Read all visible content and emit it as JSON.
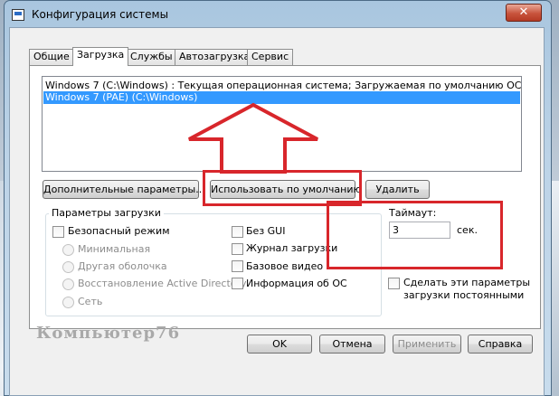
{
  "window": {
    "title": "Конфигурация системы",
    "close_glyph": "✕"
  },
  "tabs": [
    {
      "label": "Общие"
    },
    {
      "label": "Загрузка"
    },
    {
      "label": "Службы"
    },
    {
      "label": "Автозагрузка"
    },
    {
      "label": "Сервис"
    }
  ],
  "os_list": [
    "Windows 7 (C:\\Windows) : Текущая операционная система; Загружаемая по умолчанию ОС",
    "Windows 7 (PAE) (C:\\Windows)"
  ],
  "buttons": {
    "advanced": "Дополнительные параметры...",
    "set_default": "Использовать по умолчанию",
    "delete": "Удалить",
    "ok": "OK",
    "cancel": "Отмена",
    "apply": "Применить",
    "help": "Справка"
  },
  "boot_options": {
    "group_title": "Параметры загрузки",
    "safe_mode": "Безопасный режим",
    "minimal": "Минимальная",
    "alt_shell": "Другая оболочка",
    "ad_repair": "Восстановление Active Directory",
    "network": "Сеть",
    "no_gui": "Без GUI",
    "boot_log": "Журнал загрузки",
    "base_video": "Базовое видео",
    "os_boot_info": "Информация об ОС"
  },
  "timeout": {
    "label": "Таймаут:",
    "value": "3",
    "unit": "сек."
  },
  "permanent": {
    "line1": "Сделать эти параметры",
    "line2": "загрузки постоянными"
  },
  "watermark": "Компьютер76",
  "colors": {
    "highlight": "#3399ff",
    "annotation_red": "#d8262b"
  }
}
